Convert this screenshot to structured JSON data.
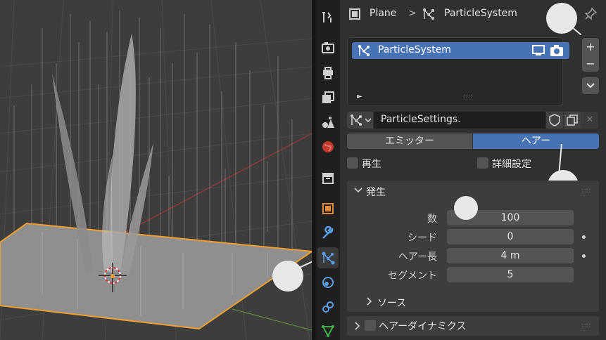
{
  "breadcrumb": {
    "object": "Plane",
    "separator": ">",
    "data": "ParticleSystem"
  },
  "particle_list": {
    "item": "ParticleSystem",
    "expand_arrow": "►",
    "grip": "::::"
  },
  "list_buttons": {
    "add": "+",
    "remove": "−",
    "menu": "⌄"
  },
  "settings_selector": {
    "name": "ParticleSettings.",
    "close": "✕"
  },
  "type_tabs": {
    "emitter": "エミッター",
    "hair": "ヘアー",
    "active": "hair"
  },
  "options": {
    "regrow": "再生",
    "advanced": "詳細設定"
  },
  "emission_panel": {
    "title": "発生",
    "fields": [
      {
        "label": "数",
        "value": "100"
      },
      {
        "label": "シード",
        "value": "0"
      },
      {
        "label": "ヘアー長",
        "value": "4 m"
      },
      {
        "label": "セグメント",
        "value": "5"
      }
    ],
    "source_subpanel": "ソース"
  },
  "hair_dynamics_panel": {
    "title": "ヘアーダイナミクス"
  },
  "colors": {
    "accent": "#4772b3",
    "selection_outline": "#f0a030",
    "panel_bg": "#303030",
    "field_bg": "#545454"
  },
  "icons": [
    "tool-icon",
    "render-icon",
    "output-icon",
    "view-layer-icon",
    "scene-icon",
    "world-icon",
    "collection-icon",
    "object-icon",
    "modifier-icon",
    "particles-icon",
    "physics-icon",
    "constraints-icon",
    "data-icon",
    "pin-icon",
    "monitor-icon",
    "camera-icon",
    "shield-icon",
    "copy-icon"
  ]
}
